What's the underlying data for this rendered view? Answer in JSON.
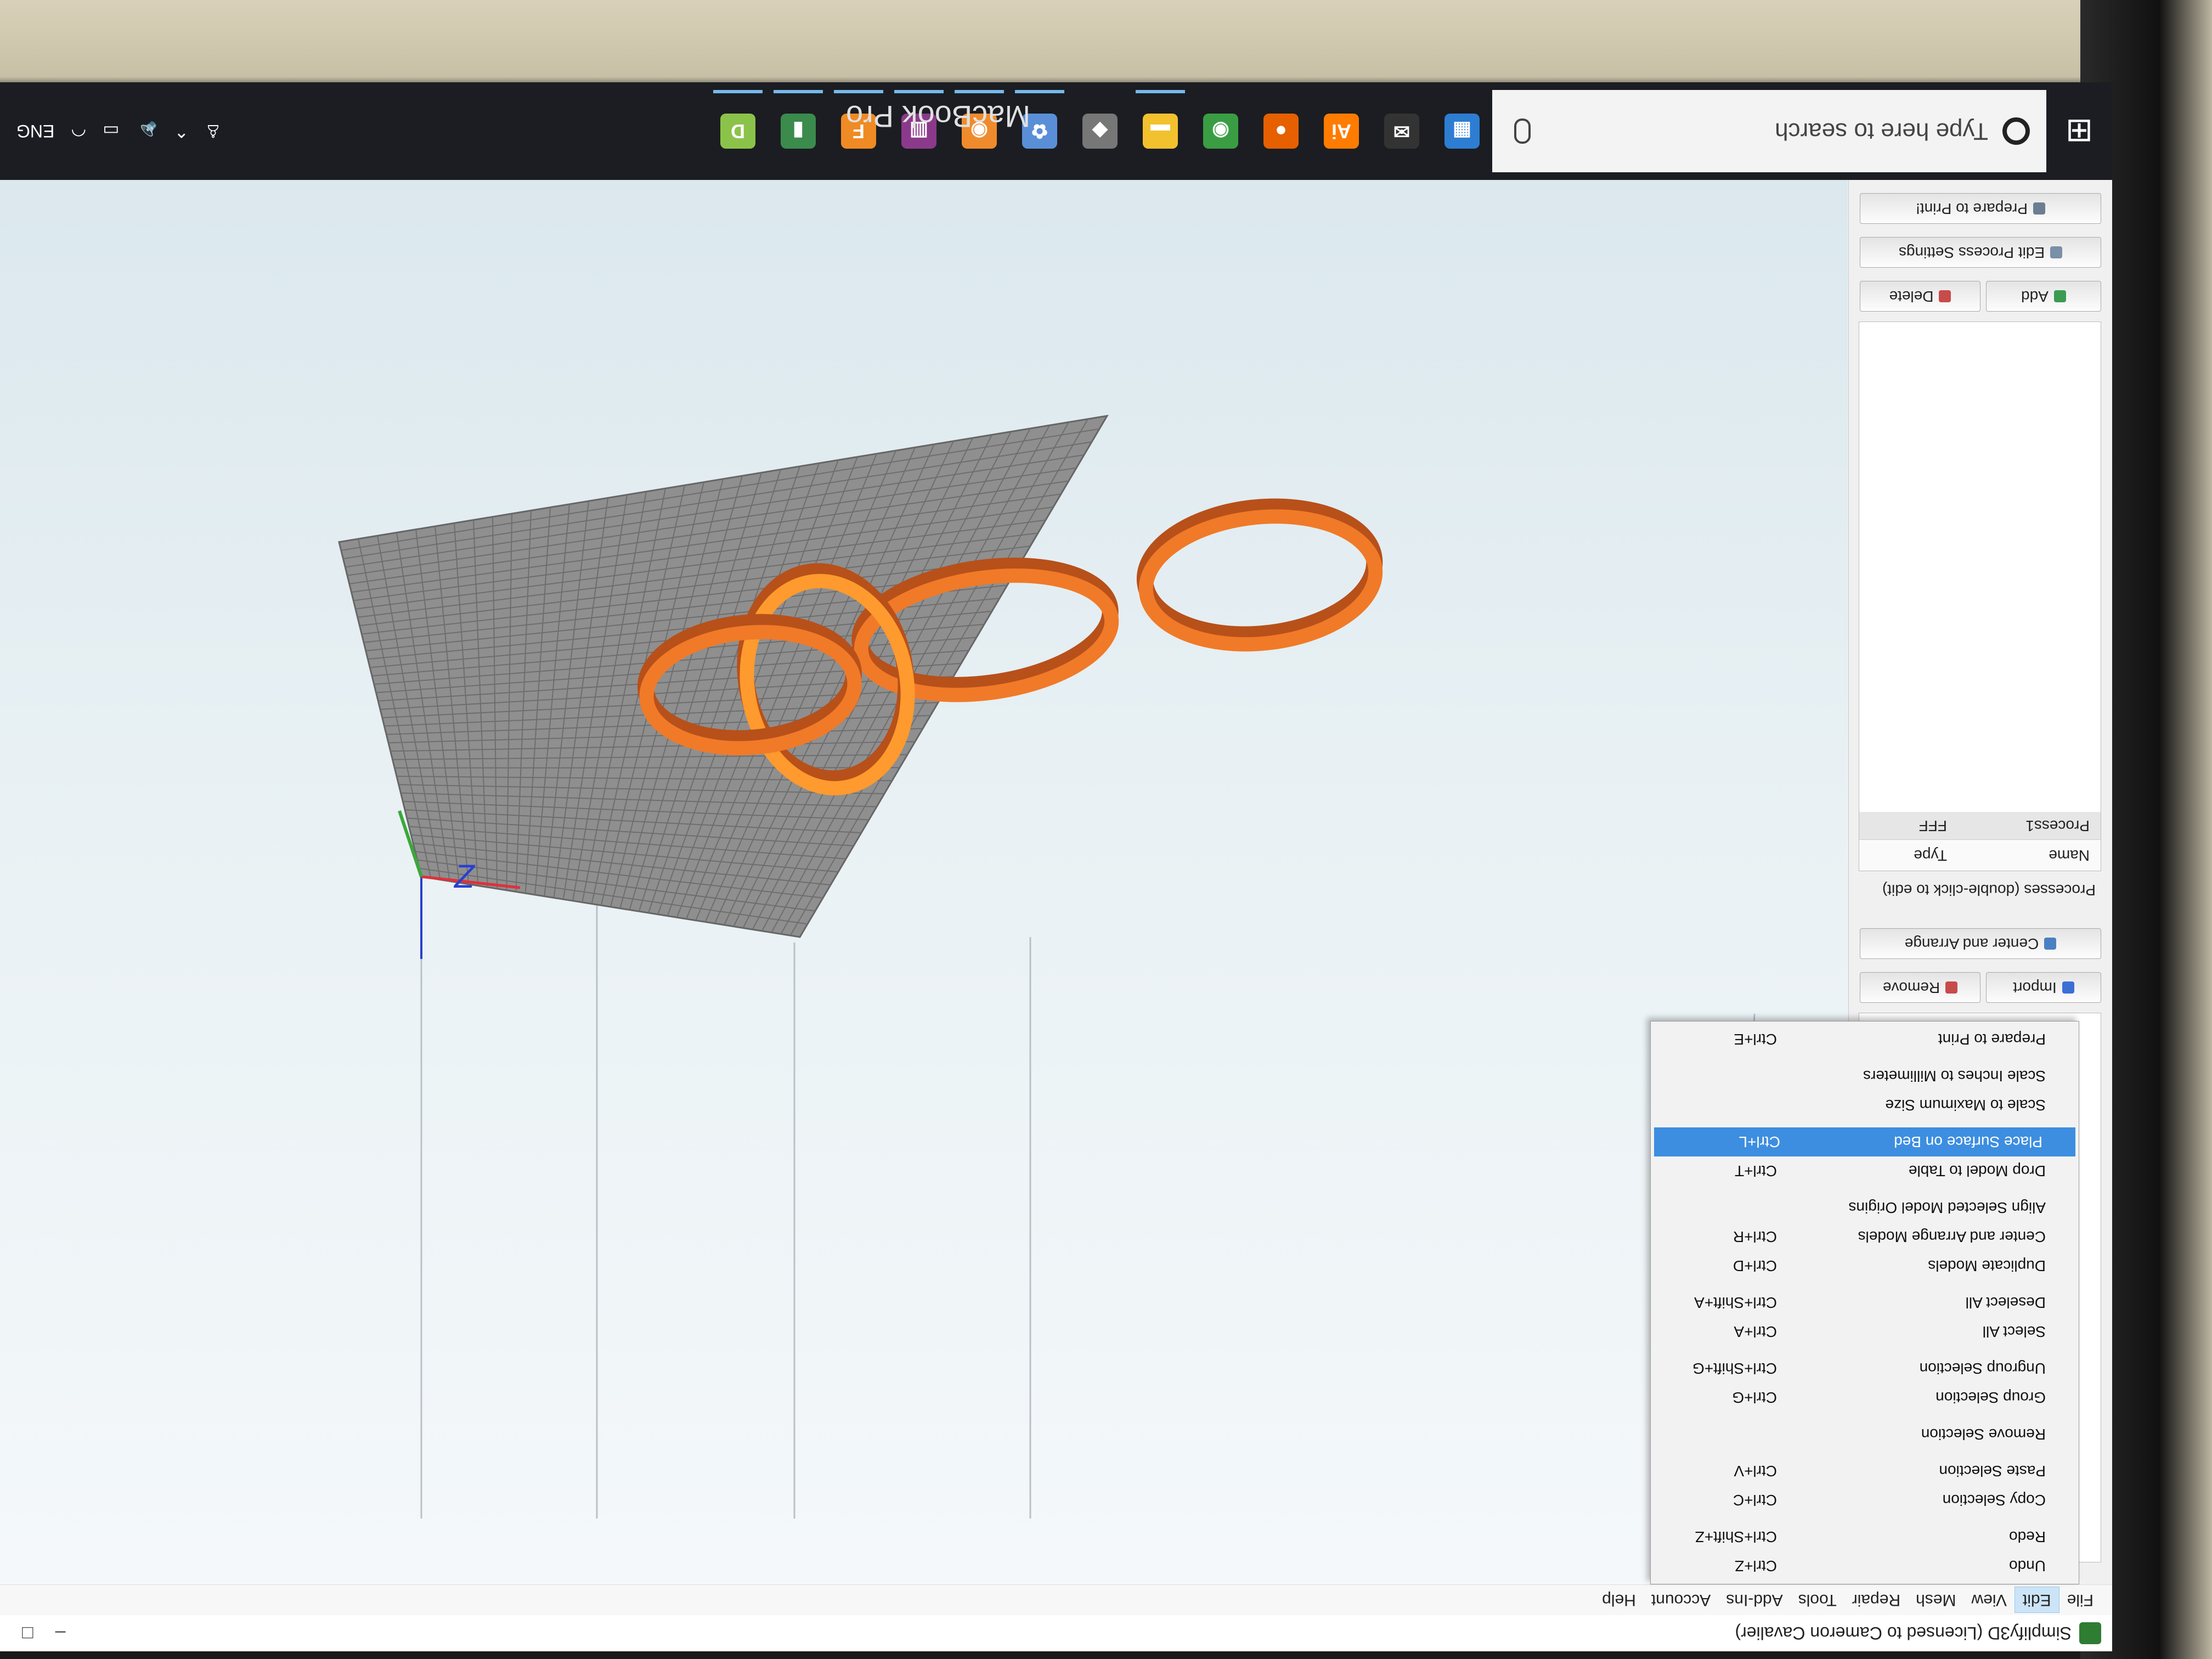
{
  "bezel": {
    "brand": "MacBook Pro"
  },
  "window": {
    "title": "Simplify3D (Licensed to Cameron Cavalier)",
    "controls": [
      "–",
      "□"
    ]
  },
  "menubar": {
    "items": [
      "File",
      "Edit",
      "View",
      "Mesh",
      "Repair",
      "Tools",
      "Add-Ins",
      "Account",
      "Help"
    ],
    "active": "Edit"
  },
  "left_panel": {
    "import_label": "Import",
    "remove_label": "Remove",
    "center_arrange_label": "Center and Arrange",
    "processes_label": "Processes (double-click to edit)",
    "columns": [
      "Name",
      "Type"
    ],
    "rows": [
      {
        "name": "Process1",
        "type": "FFF"
      }
    ],
    "add_label": "Add",
    "delete_label": "Delete",
    "edit_process_label": "Edit Process Settings",
    "prepare_label": "Prepare to Print!"
  },
  "edit_menu": {
    "items": [
      {
        "label": "Undo",
        "shortcut": "Ctrl+Z"
      },
      {
        "label": "Redo",
        "shortcut": "Ctrl+Shift+Z"
      },
      {
        "label": "Copy Selection",
        "shortcut": "Ctrl+C"
      },
      {
        "label": "Paste Selection",
        "shortcut": "Ctrl+V"
      },
      {
        "label": "Remove Selection",
        "shortcut": ""
      },
      {
        "label": "Group Selection",
        "shortcut": "Ctrl+G"
      },
      {
        "label": "Ungroup Selection",
        "shortcut": "Ctrl+Shift+G"
      },
      {
        "label": "Select All",
        "shortcut": "Ctrl+A"
      },
      {
        "label": "Deselect All",
        "shortcut": "Ctrl+Shift+A"
      },
      {
        "label": "Duplicate Models",
        "shortcut": "Ctrl+D"
      },
      {
        "label": "Center and Arrange Models",
        "shortcut": "Ctrl+R"
      },
      {
        "label": "Align Selected Model Origins",
        "shortcut": ""
      },
      {
        "label": "Drop Model to Table",
        "shortcut": "Ctrl+T"
      },
      {
        "label": "Place Surface on Bed",
        "shortcut": "Ctrl+L"
      },
      {
        "label": "Scale to Maximum Size",
        "shortcut": ""
      },
      {
        "label": "Scale Inches to Millimeters",
        "shortcut": ""
      },
      {
        "label": "Prepare to Print",
        "shortcut": "Ctrl+E"
      }
    ],
    "highlighted": "Place Surface on Bed"
  },
  "viewport": {
    "axis_label": "Z",
    "colors": {
      "bed": "#8f8f8f",
      "ring": "#f07a28",
      "ring_selected": "#ff9a2e",
      "x_axis": "#e0303a",
      "y_axis": "#3aa83a",
      "z_axis": "#2a3fd0"
    }
  },
  "taskbar": {
    "search_placeholder": "Type here to search",
    "apps": [
      {
        "icon": "store-icon",
        "glyph": "▦",
        "color": "#2d7dd2"
      },
      {
        "icon": "mail-icon",
        "glyph": "✉",
        "color": "#333"
      },
      {
        "icon": "illustrator-icon",
        "glyph": "Ai",
        "color": "#ff7c00"
      },
      {
        "icon": "firefox-icon",
        "glyph": "●",
        "color": "#e66000"
      },
      {
        "icon": "chrome-icon",
        "glyph": "◉",
        "color": "#3a9d43"
      },
      {
        "icon": "file-explorer-icon",
        "glyph": "▬",
        "color": "#f2c12e"
      },
      {
        "icon": "unity-icon",
        "glyph": "◆",
        "color": "#777"
      },
      {
        "icon": "fan-app-icon",
        "glyph": "✿",
        "color": "#5a8fd8"
      },
      {
        "icon": "chrome-canary-icon",
        "glyph": "◉",
        "color": "#ef8b2c"
      },
      {
        "icon": "winrar-icon",
        "glyph": "▥",
        "color": "#8b3a8b"
      },
      {
        "icon": "fusion-icon",
        "glyph": "F",
        "color": "#f08a24"
      },
      {
        "icon": "simplify3d-icon",
        "glyph": "▮",
        "color": "#3b8b4c"
      },
      {
        "icon": "d-app-icon",
        "glyph": "D",
        "color": "#8bc34a"
      }
    ],
    "tray_language": "ENG"
  }
}
